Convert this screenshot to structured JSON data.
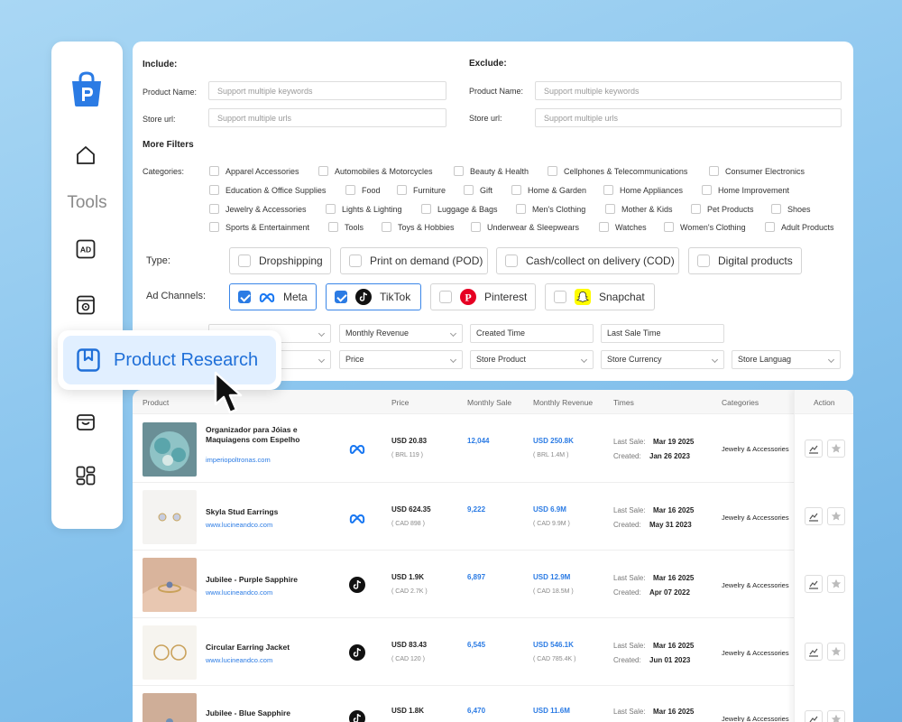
{
  "sidebar": {
    "tools_label": "Tools",
    "icons": [
      "home-icon",
      "ad-icon",
      "spy-icon",
      "product-research-icon",
      "store-icon",
      "dashboard-icon"
    ],
    "active_item": "Product Research"
  },
  "filters": {
    "include_title": "Include:",
    "exclude_title": "Exclude:",
    "product_name_label": "Product Name:",
    "store_url_label": "Store url:",
    "product_name_placeholder": "Support multiple keywords",
    "store_url_placeholder": "Support multiple urls",
    "more_filters_title": "More Filters",
    "categories_label": "Categories:",
    "categories": [
      "Apparel Accessories",
      "Automobiles & Motorcycles",
      "Beauty & Health",
      "Cellphones & Telecommunications",
      "Consumer Electronics",
      "Education & Office Supplies",
      "Food",
      "Furniture",
      "Gift",
      "Home & Garden",
      "Home Appliances",
      "Home Improvement",
      "Jewelry & Accessories",
      "Lights & Lighting",
      "Luggage & Bags",
      "Men's Clothing",
      "Mother & Kids",
      "Pet Products",
      "Shoes",
      "Sports & Entertainment",
      "Tools",
      "Toys & Hobbies",
      "Underwear & Sleepwears",
      "Watches",
      "Women's Clothing",
      "Adult Products"
    ],
    "type_label": "Type:",
    "types": [
      "Dropshipping",
      "Print on demand (POD)",
      "Cash/collect on delivery (COD)",
      "Digital products"
    ],
    "ad_channels_label": "Ad Channels:",
    "ad_channels": [
      {
        "label": "Meta",
        "checked": true
      },
      {
        "label": "TikTok",
        "checked": true
      },
      {
        "label": "Pinterest",
        "checked": false
      },
      {
        "label": "Snapchat",
        "checked": false
      }
    ],
    "dropdowns_row1": [
      "Monthly Revenue",
      "Created Time",
      "Last Sale Time"
    ],
    "dropdowns_row2": [
      "Price",
      "Store Product",
      "Store Currency",
      "Store Languag"
    ]
  },
  "table": {
    "headers": {
      "product": "Product",
      "price": "Price",
      "monthly_sale": "Monthly Sale",
      "monthly_revenue": "Monthly Revenue",
      "times": "Times",
      "categories": "Categories",
      "action": "Action"
    },
    "last_sale_label": "Last Sale:",
    "created_label": "Created:",
    "rows": [
      {
        "name": "Organizador para Jóias e Maquiagens com Espelho",
        "url": "imperiopoltronas.com",
        "channel": "meta",
        "price": "USD 20.83",
        "price_local": "( BRL 119 )",
        "monthly_sale": "12,044",
        "revenue": "USD 250.8K",
        "revenue_local": "( BRL 1.4M )",
        "last_sale": "Mar 19 2025",
        "created": "Jan 26 2023",
        "category": "Jewelry & Accessories"
      },
      {
        "name": "Skyla Stud Earrings",
        "url": "www.lucineandco.com",
        "channel": "meta",
        "price": "USD 624.35",
        "price_local": "( CAD 898 )",
        "monthly_sale": "9,222",
        "revenue": "USD 6.9M",
        "revenue_local": "( CAD 9.9M )",
        "last_sale": "Mar 16 2025",
        "created": "May 31 2023",
        "category": "Jewelry & Accessories"
      },
      {
        "name": "Jubilee - Purple Sapphire",
        "url": "www.lucineandco.com",
        "channel": "tiktok",
        "price": "USD 1.9K",
        "price_local": "( CAD 2.7K )",
        "monthly_sale": "6,897",
        "revenue": "USD 12.9M",
        "revenue_local": "( CAD 18.5M )",
        "last_sale": "Mar 16 2025",
        "created": "Apr 07 2022",
        "category": "Jewelry & Accessories"
      },
      {
        "name": "Circular Earring Jacket",
        "url": "www.lucineandco.com",
        "channel": "tiktok",
        "price": "USD 83.43",
        "price_local": "( CAD 120 )",
        "monthly_sale": "6,545",
        "revenue": "USD 546.1K",
        "revenue_local": "( CAD 785.4K )",
        "last_sale": "Mar 16 2025",
        "created": "Jun 01 2023",
        "category": "Jewelry & Accessories"
      },
      {
        "name": "Jubilee - Blue Sapphire",
        "url": "",
        "channel": "tiktok",
        "price": "USD 1.8K",
        "price_local": "",
        "monthly_sale": "6,470",
        "revenue": "USD 11.6M",
        "revenue_local": "",
        "last_sale": "Mar 16 2025",
        "created": "",
        "category": "Jewelry & Accessories"
      }
    ]
  },
  "colors": {
    "accent": "#2b7be4",
    "active_bg": "#e1efff"
  }
}
